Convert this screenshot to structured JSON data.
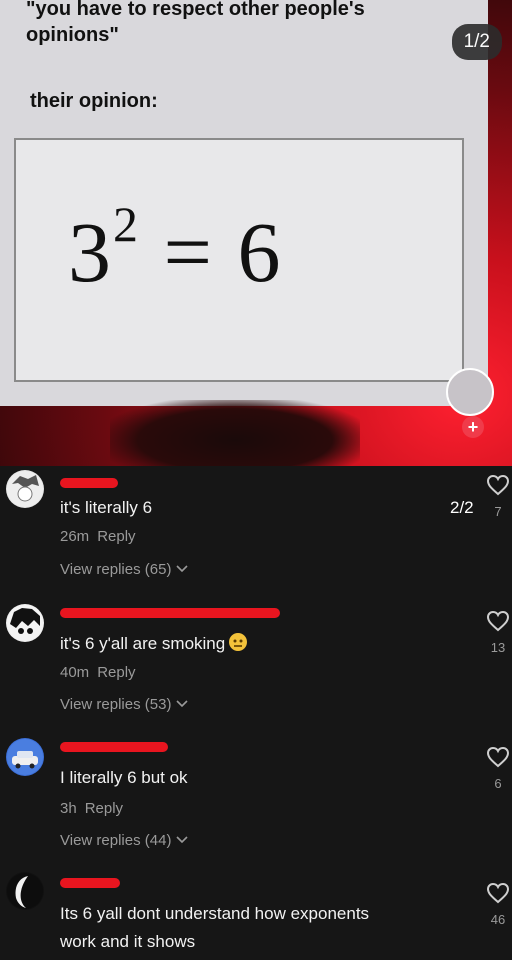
{
  "video": {
    "caption": "\"you have to respect other people's opinions\"",
    "subcaption": "their opinion:",
    "equation_base": "3",
    "equation_exp": "2",
    "equation_rest": " = 6",
    "pager": "1/2"
  },
  "page_indicator": "2/2",
  "comments": [
    {
      "text": "it's literally 6",
      "time": "26m",
      "reply": "Reply",
      "replies": "View replies (65)",
      "likes": "7"
    },
    {
      "text": "it's 6 y'all are smoking",
      "time": "40m",
      "reply": "Reply",
      "replies": "View replies (53)",
      "likes": "13"
    },
    {
      "text": "I literally 6 but ok",
      "time": "3h",
      "reply": "Reply",
      "replies": "View replies (44)",
      "likes": "6"
    },
    {
      "text_line1": "Its 6 yall dont understand how exponents",
      "text_line2": "work and it shows",
      "likes": "46"
    }
  ],
  "colors": {
    "accent": "#e8151f",
    "background": "#161616"
  },
  "icons": {
    "heart": "heart-outline-icon",
    "chevron": "chevron-down-icon",
    "plus": "plus-icon"
  }
}
